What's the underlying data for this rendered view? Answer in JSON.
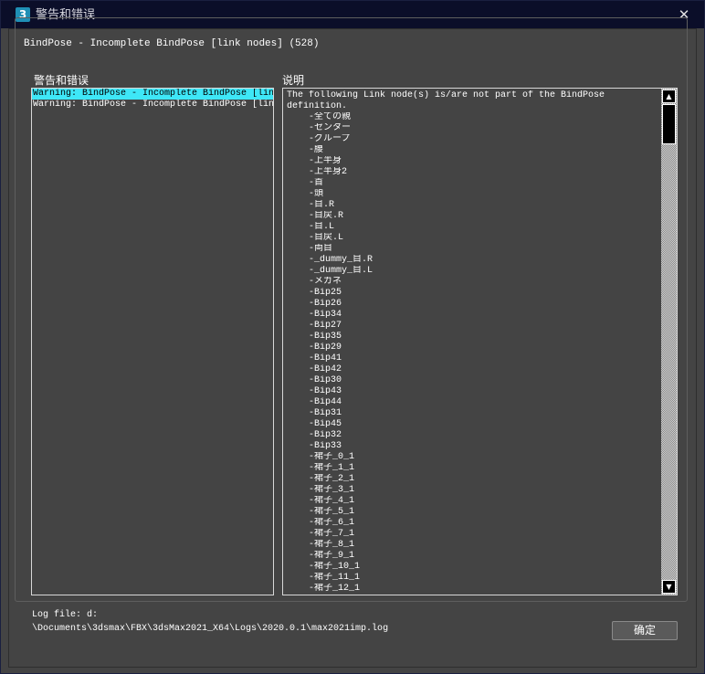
{
  "window": {
    "app_icon": "3",
    "title": "警告和错误",
    "close_glyph": "✕"
  },
  "group_label": "BindPose - Incomplete BindPose [link nodes] (528)",
  "columns": {
    "warnings_label": "警告和错误",
    "description_label": "说明"
  },
  "warnings": [
    "Warning: BindPose - Incomplete BindPose [link nodes] (528)",
    "Warning: BindPose - Incomplete BindPose [link nodes] (528)"
  ],
  "description": {
    "intro_line1": "The following Link node(s) is/are not part of the BindPose",
    "intro_line2": "definition.",
    "nodes": [
      "-全ての親",
      "-センター",
      "-グループ",
      "-腰",
      "-上半身",
      "-上半身2",
      "-首",
      "-頭",
      "-目.R",
      "-目戻.R",
      "-目.L",
      "-目戻.L",
      "-両目",
      "-_dummy_目.R",
      "-_dummy_目.L",
      "-メガネ",
      "-Bip25",
      "-Bip26",
      "-Bip34",
      "-Bip27",
      "-Bip35",
      "-Bip29",
      "-Bip41",
      "-Bip42",
      "-Bip30",
      "-Bip43",
      "-Bip44",
      "-Bip31",
      "-Bip45",
      "-Bip32",
      "-Bip33",
      "-裙子_0_1",
      "-裙子_1_1",
      "-裙子_2_1",
      "-裙子_3_1",
      "-裙子_4_1",
      "-裙子_5_1",
      "-裙子_6_1",
      "-裙子_7_1",
      "-裙子_8_1",
      "-裙子_9_1",
      "-裙子_10_1",
      "-裙子_11_1",
      "-裙子_12_1"
    ]
  },
  "scrollbar": {
    "up_arrow": "▲",
    "down_arrow": "▼"
  },
  "logfile": {
    "line1": "Log file: d:",
    "line2": "\\Documents\\3dsmax\\FBX\\3dsMax2021_X64\\Logs\\2020.0.1\\max2021imp.log"
  },
  "ok_button": "确定"
}
